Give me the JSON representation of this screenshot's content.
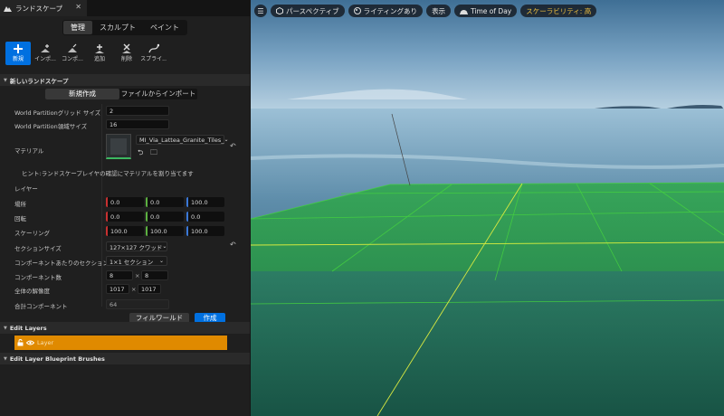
{
  "tab": {
    "title": "ランドスケープ"
  },
  "modes": [
    "管理",
    "スカルプト",
    "ペイント"
  ],
  "tools": [
    "新規",
    "インポ...",
    "コンポ...",
    "追加",
    "削除",
    "スプライ..."
  ],
  "new_landscape": {
    "header": "新しいランドスケープ",
    "subtabs": [
      "新規作成",
      "ファイルからインポート"
    ],
    "grid_size": {
      "label": "World Partitionグリッド サイズ",
      "value": "2"
    },
    "region_size": {
      "label": "World Partition領域サイズ",
      "value": "16"
    },
    "material": {
      "label": "マテリアル",
      "value": "MI_Via_Lattea_Granite_Tiles_"
    },
    "hint": "ヒント:ランドスケープレイヤの確認にマテリアルを割り当てます",
    "layers_label": "レイヤー",
    "location": {
      "label": "場所",
      "x": "0.0",
      "y": "0.0",
      "z": "100.0"
    },
    "rotation": {
      "label": "回転",
      "x": "0.0",
      "y": "0.0",
      "z": "0.0"
    },
    "scale": {
      "label": "スケーリング",
      "x": "100.0",
      "y": "100.0",
      "z": "100.0"
    },
    "section_size": {
      "label": "セクションサイズ",
      "value": "127×127 クワッド"
    },
    "sections_per_component": {
      "label": "コンポーネントあたりのセクション",
      "value": "1×1 セクション"
    },
    "component_count": {
      "label": "コンポーネント数",
      "x": "8",
      "y": "8"
    },
    "overall_resolution": {
      "label": "全体の解像度",
      "x": "1017",
      "y": "1017"
    },
    "total_components": {
      "label": "合計コンポーネント",
      "value": "64"
    },
    "fill_world_button": "フィルワールド",
    "create_button": "作成"
  },
  "edit_layers": {
    "header": "Edit Layers",
    "layer_name": "Layer"
  },
  "edit_layer_brushes": {
    "header": "Edit Layer Blueprint Brushes"
  },
  "viewport": {
    "perspective": "パースペクティブ",
    "lighting": "ライティングあり",
    "show": "表示",
    "time_of_day": "Time of Day",
    "scalability": "スケーラビリティ: 高"
  },
  "colors": {
    "accent": "#0070e0",
    "layer_selected": "#e08a00",
    "grid": "#44d040"
  }
}
